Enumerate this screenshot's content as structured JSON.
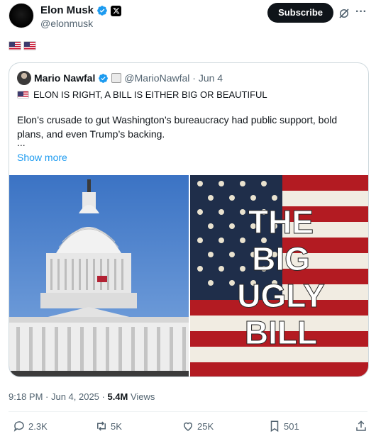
{
  "author": {
    "display_name": "Elon Musk",
    "handle": "@elonmusk"
  },
  "actions_top": {
    "subscribe_label": "Subscribe"
  },
  "post": {
    "flags": [
      "us-flag",
      "us-flag"
    ]
  },
  "quote": {
    "display_name": "Mario Nawfal",
    "handle_meta": "@MarioNawfal · Jun 4",
    "title": "ELON IS RIGHT, A BILL IS EITHER BIG OR BEAUTIFUL",
    "body": "Elon’s crusade to gut Washington’s bureaucracy had public support, bold plans, and even Trump’s backing.",
    "ellipsis": "...",
    "show_more": "Show more",
    "image_text": [
      "THE",
      "BIG",
      "UGLY",
      "BILL"
    ]
  },
  "meta": {
    "time_date": "9:18 PM · Jun 4, 2025 · ",
    "views_count": "5.4M",
    "views_label": " Views"
  },
  "engagement": {
    "replies": "2.3K",
    "reposts": "5K",
    "likes": "25K",
    "bookmarks": "501"
  },
  "colors": {
    "accent": "#1d9bf0",
    "text": "#0f1419",
    "muted": "#536471",
    "border": "#cfd9de"
  }
}
